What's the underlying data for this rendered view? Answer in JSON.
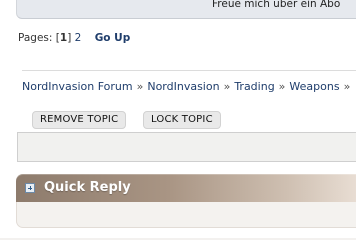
{
  "post_footer": {
    "signature_text": "Freue mich über ein Abo"
  },
  "pagination": {
    "label": "Pages:",
    "open_bracket": "[",
    "current_page": "1",
    "close_bracket": "]",
    "other_page": "2",
    "go_up": "Go Up"
  },
  "breadcrumb": {
    "items": [
      "NordInvasion Forum",
      "NordInvasion",
      "Trading",
      "Weapons"
    ],
    "separator": "»"
  },
  "moderation": {
    "remove_topic": "REMOVE TOPIC",
    "lock_topic": "LOCK TOPIC"
  },
  "quick_reply": {
    "title": "Quick Reply",
    "icon": "expand-plus-icon"
  },
  "colors": {
    "link": "#1f3d6b",
    "quick_reply_bar": "#8d7b6c"
  }
}
